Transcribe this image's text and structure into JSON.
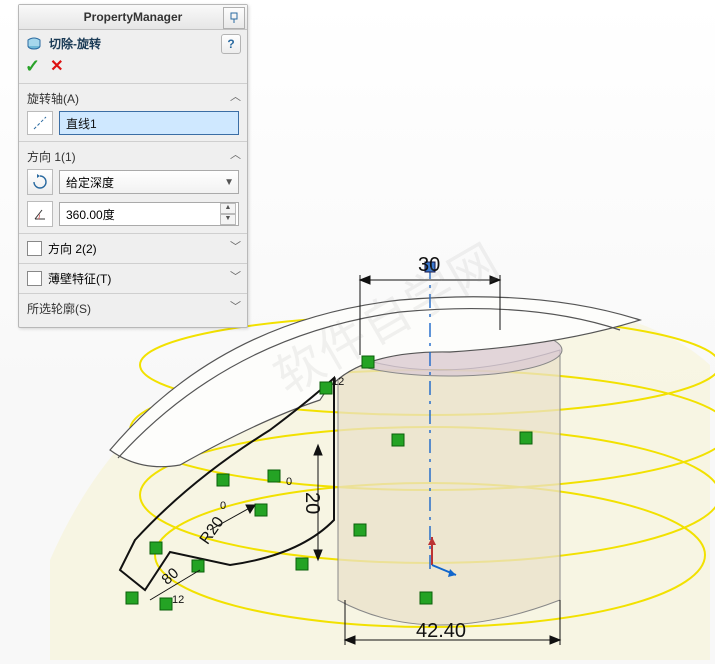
{
  "panel": {
    "title": "PropertyManager",
    "feature_name": "切除-旋转",
    "help": "?",
    "ok": "✓",
    "cancel": "✕"
  },
  "axis": {
    "header": "旋转轴(A)",
    "value": "直线1"
  },
  "direction1": {
    "header": "方向 1(1)",
    "end_condition": "给定深度",
    "angle": "360.00度"
  },
  "direction2": {
    "label": "方向 2(2)",
    "checked": false
  },
  "thin": {
    "label": "薄壁特征(T)",
    "checked": false
  },
  "contour": {
    "header": "所选轮廓(S)"
  },
  "dimensions": {
    "d30": "30",
    "d20": "20",
    "d4240": "42.40",
    "r20": "R20",
    "d80": "80",
    "d12a": "12",
    "d12b": "12",
    "d0a": "0",
    "d0b": "0"
  },
  "watermark": "软件自学网"
}
